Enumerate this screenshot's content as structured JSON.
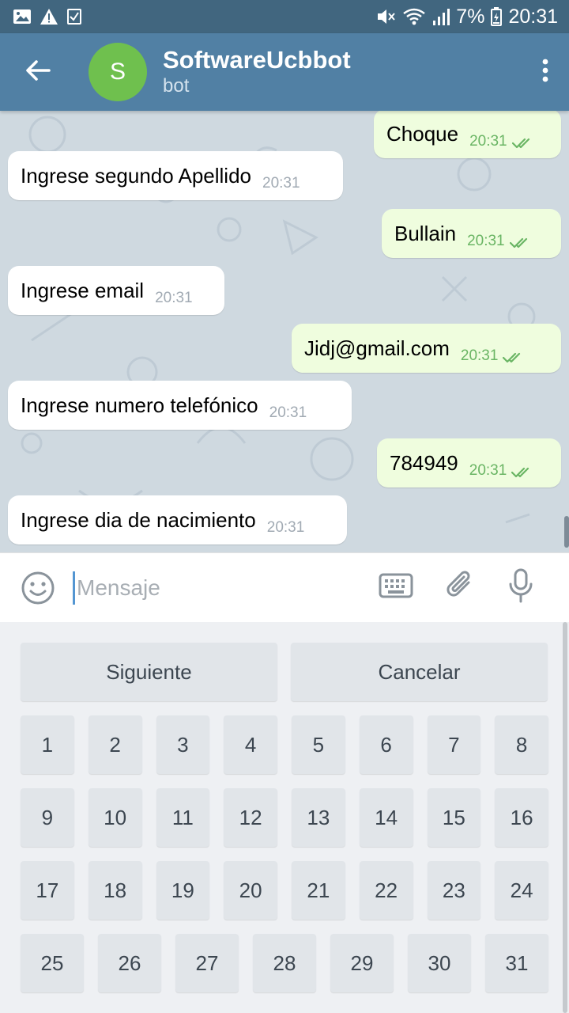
{
  "status_bar": {
    "battery": "7%",
    "time": "20:31"
  },
  "header": {
    "avatar_letter": "S",
    "title": "SoftwareUcbbot",
    "subtitle": "bot"
  },
  "messages": [
    {
      "dir": "out",
      "text": "Choque",
      "time": "20:31"
    },
    {
      "dir": "in",
      "text": "Ingrese segundo Apellido",
      "time": "20:31"
    },
    {
      "dir": "out",
      "text": "Bullain",
      "time": "20:31"
    },
    {
      "dir": "in",
      "text": "Ingrese email",
      "time": "20:31"
    },
    {
      "dir": "out",
      "text": "Jidj@gmail.com",
      "time": "20:31"
    },
    {
      "dir": "in",
      "text": "Ingrese numero telefónico",
      "time": "20:31"
    },
    {
      "dir": "out",
      "text": "784949",
      "time": "20:31"
    },
    {
      "dir": "in",
      "text": "Ingrese dia de nacimiento",
      "time": "20:31"
    }
  ],
  "input": {
    "placeholder": "Mensaje",
    "value": ""
  },
  "keyboard": {
    "action_row": [
      "Siguiente",
      "Cancelar"
    ],
    "number_rows": [
      [
        "1",
        "2",
        "3",
        "4",
        "5",
        "6",
        "7",
        "8"
      ],
      [
        "9",
        "10",
        "11",
        "12",
        "13",
        "14",
        "15",
        "16"
      ],
      [
        "17",
        "18",
        "19",
        "20",
        "21",
        "22",
        "23",
        "24"
      ],
      [
        "25",
        "26",
        "27",
        "28",
        "29",
        "30",
        "31"
      ]
    ]
  },
  "colors": {
    "status_bar": "#41667f",
    "header": "#5180a4",
    "avatar": "#6fc04e",
    "incoming_bubble": "#ffffff",
    "outgoing_bubble": "#effdde",
    "read_check": "#6ab564"
  },
  "icons": {
    "back": "arrow-back-icon",
    "menu": "more-vert-icon",
    "emoji": "emoji-icon",
    "keyboard": "keyboard-icon",
    "attach": "paperclip-icon",
    "mic": "microphone-icon"
  }
}
